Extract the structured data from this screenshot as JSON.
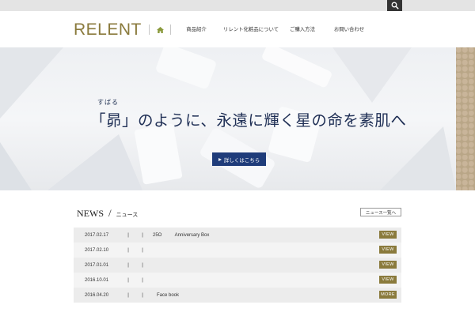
{
  "header": {
    "logo": "RELENT",
    "nav": [
      {
        "label": "商品紹介"
      },
      {
        "label": "リレント化粧品について"
      },
      {
        "label": "ご購入方法"
      },
      {
        "label": "お問い合わせ"
      }
    ]
  },
  "hero": {
    "ruby": "すばる",
    "tagline": "「昴」のように、永遠に輝く星の命を素肌へ",
    "button_label": "詳しくはこちら"
  },
  "news": {
    "title_en": "NEWS",
    "slash": "/",
    "title_jp": "ニュース",
    "all_label": "ニュース一覧へ",
    "items": [
      {
        "date": "2017.02.17",
        "bar": "|",
        "bar2": "|",
        "text": "25O          Anniversary Box",
        "tag": "VIEW"
      },
      {
        "date": "2017.02.10",
        "bar": "|",
        "bar2": "|",
        "text": "",
        "tag": "VIEW"
      },
      {
        "date": "2017.01.01",
        "bar": "|",
        "bar2": "|",
        "text": "",
        "tag": "VIEW"
      },
      {
        "date": "2016.10.01",
        "bar": "|",
        "bar2": "|",
        "text": "",
        "tag": "VIEW"
      },
      {
        "date": "2016.04.20",
        "bar": "|",
        "bar2": "|",
        "text": "   Face book",
        "tag": "MORE"
      }
    ]
  },
  "colors": {
    "accent": "#8a7a3c",
    "button": "#1f3c7a",
    "headline": "#1f2f55"
  }
}
